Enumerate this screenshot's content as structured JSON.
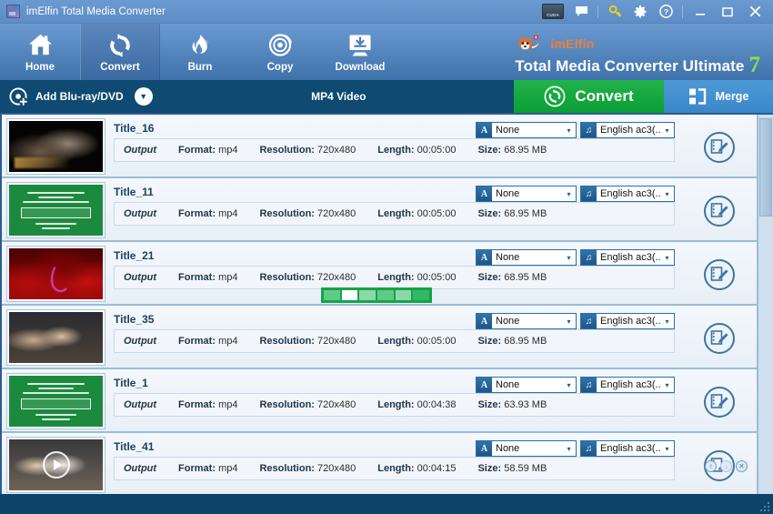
{
  "window": {
    "title": "imElfin Total Media Converter",
    "app_icon": "app-logo-icon",
    "controls": {
      "cuda_label": "CUDA",
      "feedback": "⬜",
      "key": "🔑",
      "settings": "⚙",
      "help": "?",
      "minimize": "–",
      "maximize": "☐",
      "close": "✕"
    }
  },
  "nav": {
    "items": [
      {
        "label": "Home",
        "icon": "home-icon",
        "active": false
      },
      {
        "label": "Convert",
        "icon": "convert-icon",
        "active": true
      },
      {
        "label": "Burn",
        "icon": "flame-icon",
        "active": false
      },
      {
        "label": "Copy",
        "icon": "disc-icon",
        "active": false
      },
      {
        "label": "Download",
        "icon": "download-icon",
        "active": false
      }
    ]
  },
  "brand": {
    "mascot": "fox-mascot-icon",
    "name": "imElfin",
    "product": "Total Media Converter Ultimate",
    "version": "7",
    "name_color": "#f0803c",
    "version_color": "#8ede4a"
  },
  "actionbar": {
    "add_label": "Add Blu-ray/DVD",
    "add_icon": "add-disc-icon",
    "dropdown_icon": "chevron-down-icon",
    "format": "MP4 Video",
    "convert_label": "Convert",
    "convert_icon": "convert-circle-icon",
    "convert_color": "#0fa73e",
    "merge_label": "Merge",
    "merge_icon": "merge-icon",
    "merge_color": "#4093d2"
  },
  "list": {
    "labels": {
      "output": "Output",
      "format": "Format:",
      "resolution": "Resolution:",
      "length": "Length:",
      "size": "Size:"
    },
    "rows": [
      {
        "title": "Title_16",
        "format": "mp4",
        "resolution": "720x480",
        "length": "00:05:00",
        "size": "68.95 MB",
        "subtitle": "None",
        "audio": "English ac3(..",
        "thumb": "th-dark",
        "progress": false,
        "play": false,
        "tools": false
      },
      {
        "title": "Title_11",
        "format": "mp4",
        "resolution": "720x480",
        "length": "00:05:00",
        "size": "68.95 MB",
        "subtitle": "None",
        "audio": "English ac3(..",
        "thumb": "th-green",
        "progress": false,
        "play": false,
        "tools": false
      },
      {
        "title": "Title_21",
        "format": "mp4",
        "resolution": "720x480",
        "length": "00:05:00",
        "size": "68.95 MB",
        "subtitle": "None",
        "audio": "English ac3(..",
        "thumb": "th-red",
        "progress": true,
        "play": false,
        "tools": false
      },
      {
        "title": "Title_35",
        "format": "mp4",
        "resolution": "720x480",
        "length": "00:05:00",
        "size": "68.95 MB",
        "subtitle": "None",
        "audio": "English ac3(..",
        "thumb": "th-people",
        "progress": false,
        "play": false,
        "tools": false
      },
      {
        "title": "Title_1",
        "format": "mp4",
        "resolution": "720x480",
        "length": "00:04:38",
        "size": "63.93 MB",
        "subtitle": "None",
        "audio": "English ac3(..",
        "thumb": "th-green",
        "progress": false,
        "play": false,
        "tools": false
      },
      {
        "title": "Title_41",
        "format": "mp4",
        "resolution": "720x480",
        "length": "00:04:15",
        "size": "58.59 MB",
        "subtitle": "None",
        "audio": "English ac3(..",
        "thumb": "th-studio",
        "progress": false,
        "play": true,
        "tools": true
      }
    ],
    "tools": {
      "move_up": "↑",
      "move_down": "↓",
      "remove": "✕"
    },
    "subtitle_icon": "A",
    "audio_icon": "♫",
    "dropdown_arrow": "▾",
    "edit_icon": "edit-video-icon"
  }
}
